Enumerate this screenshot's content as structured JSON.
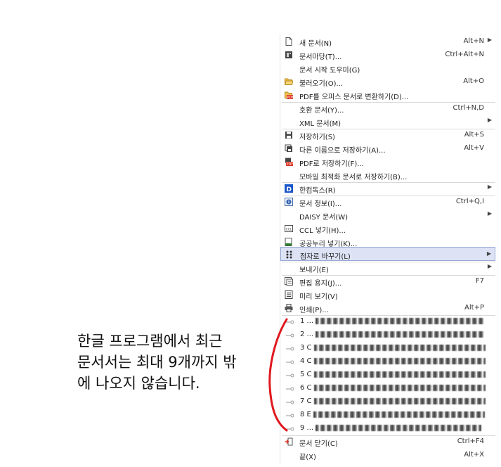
{
  "menu": {
    "items": [
      {
        "label": "새 문서(N)",
        "shortcut": "Alt+N",
        "submenu": true,
        "icon": "new-document-icon"
      },
      {
        "label": "문서마당(T)...",
        "shortcut": "Ctrl+Alt+N",
        "submenu": false,
        "icon": "document-templates-icon"
      },
      {
        "label": "문서 시작 도우미(G)",
        "shortcut": "",
        "submenu": false,
        "icon": ""
      },
      {
        "label": "불러오기(O)...",
        "shortcut": "Alt+O",
        "submenu": false,
        "icon": "folder-open-icon"
      },
      {
        "label": "PDF를 오피스 문서로 변환하기(D)...",
        "shortcut": "",
        "submenu": false,
        "icon": "pdf-convert-icon"
      },
      {
        "label": "호환 문서(Y)...",
        "shortcut": "Ctrl+N,D",
        "submenu": false,
        "icon": ""
      },
      {
        "label": "XML 문서(M)",
        "shortcut": "",
        "submenu": true,
        "icon": ""
      },
      {
        "label": "저장하기(S)",
        "shortcut": "Alt+S",
        "submenu": false,
        "icon": "save-icon"
      },
      {
        "label": "다른 이름으로 저장하기(A)...",
        "shortcut": "Alt+V",
        "submenu": false,
        "icon": "save-as-icon"
      },
      {
        "label": "PDF로 저장하기(F)...",
        "shortcut": "",
        "submenu": false,
        "icon": "save-pdf-icon"
      },
      {
        "label": "모바일 최적화 문서로 저장하기(B)...",
        "shortcut": "",
        "submenu": false,
        "icon": ""
      },
      {
        "label": "한컴독스(R)",
        "shortcut": "",
        "submenu": true,
        "icon": "hancom-docs-icon"
      },
      {
        "label": "문서 정보(I)...",
        "shortcut": "Ctrl+Q,I",
        "submenu": false,
        "icon": "document-info-icon"
      },
      {
        "label": "DAISY 문서(W)",
        "shortcut": "",
        "submenu": true,
        "icon": ""
      },
      {
        "label": "CCL 넣기(H)...",
        "shortcut": "",
        "submenu": false,
        "icon": "ccl-icon"
      },
      {
        "label": "공공누리 넣기(K)...",
        "shortcut": "",
        "submenu": false,
        "icon": "kogl-icon"
      },
      {
        "label": "점자로 바꾸기(L)",
        "shortcut": "",
        "submenu": true,
        "icon": "braille-icon"
      },
      {
        "label": "보내기(E)",
        "shortcut": "",
        "submenu": true,
        "icon": ""
      },
      {
        "label": "편집 용지(J)...",
        "shortcut": "F7",
        "submenu": false,
        "icon": "page-setup-icon"
      },
      {
        "label": "미리 보기(V)",
        "shortcut": "",
        "submenu": false,
        "icon": "print-preview-icon"
      },
      {
        "label": "인쇄(P)...",
        "shortcut": "Alt+P",
        "submenu": false,
        "icon": "print-icon"
      }
    ],
    "recent_prefixes": [
      "1 ...",
      "2 ...",
      "3 C",
      "4 C",
      "5 C",
      "6 C",
      "7 C",
      "8 E",
      "9 ..."
    ],
    "footer": [
      {
        "label": "문서 닫기(C)",
        "shortcut": "Ctrl+F4",
        "icon": "close-document-icon"
      },
      {
        "label": "끝(X)",
        "shortcut": "Alt+X",
        "icon": ""
      }
    ]
  },
  "annotation": {
    "lines": [
      "한글 프로그램에서 최근",
      "문서서는 최대 9개까지 밖",
      "에 나오지 않습니다."
    ]
  },
  "colors": {
    "highlight": "#dde3f5",
    "highlight_border": "#9aa8d8",
    "arrow": "#e0191f"
  }
}
